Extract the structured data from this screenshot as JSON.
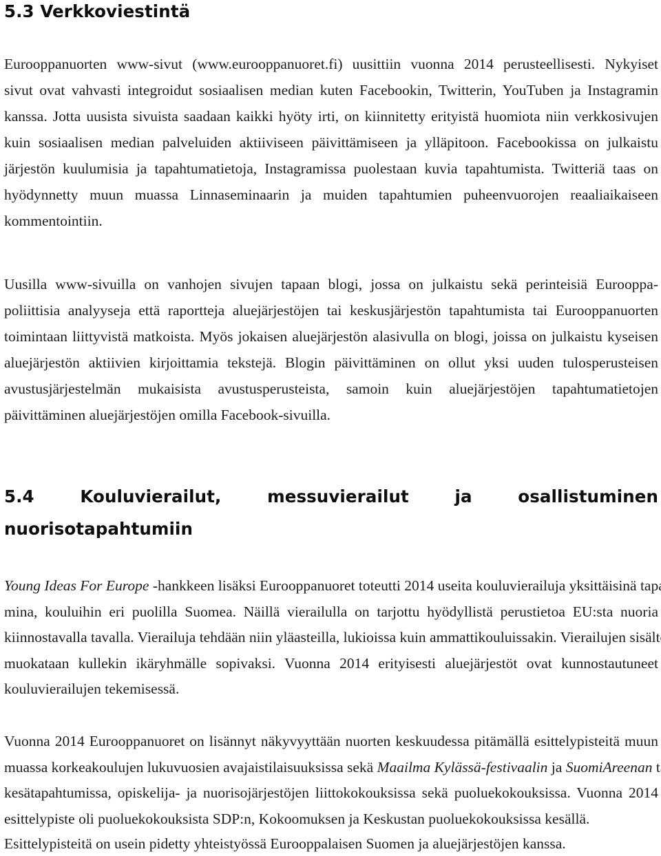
{
  "document": {
    "language": "fi",
    "sections": [
      {
        "number": "5.3",
        "title": "5.3 Verkkoviestintä"
      },
      {
        "number": "5.4",
        "title_line1": "5.4   Kouluvierailut,   messuvierailut   ja   osallistuminen",
        "title_line2": "nuorisotapahtumiin"
      }
    ]
  },
  "paragraph1": {
    "lines": [
      "Eurooppanuorten www-sivut (www.eurooppanuoret.fi) uusittiin vuonna 2014 perusteellisesti. Nykyiset",
      "sivut ovat vahvasti integroidut sosiaalisen median kuten Facebookin, Twitterin, YouTuben ja Instagramin",
      "kanssa. Jotta uusista sivuista saadaan kaikki hyöty irti, on kiinnitetty erityistä huomiota niin verkkosivujen",
      "kuin sosiaalisen median palveluiden aktiiviseen päivittämiseen ja ylläpitoon. Facebookissa on julkaistu",
      "järjestön kuulumisia ja tapahtumatietoja, Instagramissa puolestaan kuvia tapahtumista. Twitteriä taas on",
      "hyödynnetty muun muassa Linnaseminaarin ja muiden tapahtumien puheenvuorojen reaaliaikaiseen",
      "kommentointiin."
    ]
  },
  "paragraph2": {
    "lines": [
      "Uusilla www-sivuilla on vanhojen sivujen tapaan blogi, jossa on julkaistu sekä perinteisiä Eurooppa-",
      "poliittisia analyyseja että raportteja aluejärjestöjen tai keskusjärjestön tapahtumista tai Eurooppanuorten",
      "toimintaan liittyvistä matkoista. Myös jokaisen aluejärjestön alasivulla on blogi, joissa on julkaistu kyseisen",
      "aluejärjestön aktiivien kirjoittamia tekstejä. Blogin päivittäminen on ollut yksi uuden tulosperusteisen",
      "avustusjärjestelmän mukaisista avustusperusteista, samoin kuin aluejärjestöjen tapahtumatietojen",
      "päivittäminen aluejärjestöjen omilla Facebook-sivuilla."
    ]
  },
  "paragraph3": {
    "line1_italic": "Young Ideas For Europe",
    "line1_rest": " -hankkeen lisäksi Eurooppanuoret toteutti 2014 useita kouluvierailuja yksittäisinä tapahtu-",
    "lines": [
      "mina, kouluihin eri puolilla Suomea. Näillä vierailulla on tarjottu hyödyllistä perustietoa EU:sta nuoria",
      "kiinnostavalla tavalla. Vierailuja tehdään niin yläasteilla, lukioissa kuin ammattikouluissakin. Vierailujen sisältö",
      "muokataan kullekin ikäryhmälle sopivaksi. Vuonna 2014 erityisesti aluejärjestöt ovat kunnostautuneet",
      "kouluvierailujen tekemisessä."
    ]
  },
  "paragraph4": {
    "line1": "Vuonna 2014 Eurooppanuoret on lisännyt näkyvyyttään nuorten keskuudessa pitämällä esittelypisteitä muun",
    "line2_pre": "muassa korkeakoulujen lukuvuosien avajaistilaisuuksissa sekä ",
    "line2_italic1": "Maailma Kylässä-festivaalin",
    "line2_mid": " ja ",
    "line2_italic2": "SuomiAreenan",
    "line2_post": " tapaisissa",
    "line3": "kesätapahtumissa, opiskelija- ja nuorisojärjestöjen liittokokouksissa sekä puoluekokouksissa. Vuonna 2014",
    "line4": "esittelypiste oli puoluekokouksista SDP:n, Kokoomuksen ja Keskustan puoluekokouksissa kesällä.",
    "line5": "Esittelypisteitä on usein pidetty yhteistyössä Eurooppalaisen Suomen ja aluejärjestöjen kanssa."
  },
  "colors": {
    "page_background": "#ffffff",
    "body_text": "#1c1c1c",
    "heading_text": "#0d0d0d"
  }
}
